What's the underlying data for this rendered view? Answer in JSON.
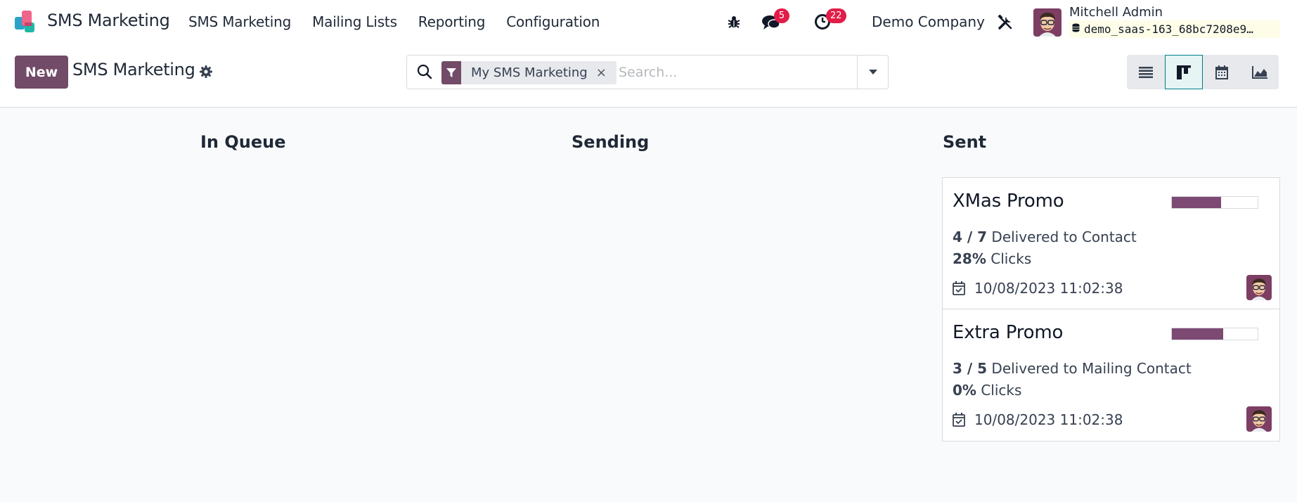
{
  "navbar": {
    "app_name": "SMS Marketing",
    "menu": [
      "SMS Marketing",
      "Mailing Lists",
      "Reporting",
      "Configuration"
    ],
    "messages_count": "5",
    "activities_count": "22",
    "company": "Demo Company",
    "user_name": "Mitchell Admin",
    "database": "demo_saas-163_68bc7208e9…"
  },
  "control": {
    "new_label": "New",
    "title": "SMS Marketing",
    "search": {
      "facet": "My SMS Marketing",
      "facet_remove": "×",
      "placeholder": "Search..."
    },
    "views": [
      "list-view",
      "kanban-view",
      "calendar-view",
      "graph-view"
    ],
    "active_view": "kanban-view"
  },
  "kanban": {
    "columns": [
      {
        "title": "In Queue"
      },
      {
        "title": "Sending"
      },
      {
        "title": "Sent"
      }
    ],
    "cards": [
      {
        "name": "XMas Promo",
        "progress": 0.57,
        "delivered": "4 / 7",
        "delivered_label": " Delivered to Contact",
        "clicks": "28%",
        "clicks_label": " Clicks",
        "date": "10/08/2023 11:02:38"
      },
      {
        "name": "Extra Promo",
        "progress": 0.6,
        "delivered": "3 / 5",
        "delivered_label": " Delivered to Mailing Contact",
        "clicks": "0%",
        "clicks_label": " Clicks",
        "date": "10/08/2023 11:02:38"
      }
    ]
  },
  "colors": {
    "brand": "#714b67",
    "progress": "#7d4a73",
    "badge": "#e11d48",
    "active_view_border": "#017e84"
  }
}
